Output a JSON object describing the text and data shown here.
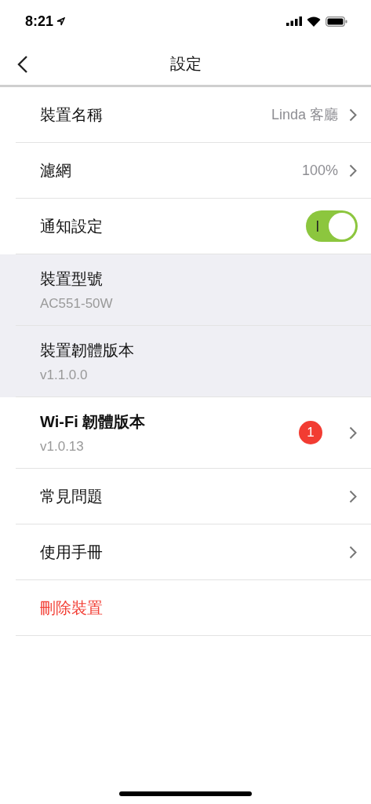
{
  "status_bar": {
    "time": "8:21"
  },
  "nav": {
    "title": "設定"
  },
  "rows": [
    {
      "kind": "link",
      "label": "裝置名稱",
      "value": "Linda 客廳"
    },
    {
      "kind": "link",
      "label": "濾網",
      "value": "100%"
    },
    {
      "kind": "toggle",
      "label": "通知設定",
      "on": true
    },
    {
      "kind": "info",
      "label": "裝置型號",
      "subtitle": "AC551-50W"
    },
    {
      "kind": "info",
      "label": "裝置韌體版本",
      "subtitle": "v1.1.0.0"
    },
    {
      "kind": "link",
      "label": "Wi-Fi 韌體版本",
      "subtitle": "v1.0.13",
      "badge": "1"
    },
    {
      "kind": "link",
      "label": "常見問題"
    },
    {
      "kind": "link",
      "label": "使用手冊"
    },
    {
      "kind": "danger",
      "label": "刪除裝置"
    }
  ]
}
